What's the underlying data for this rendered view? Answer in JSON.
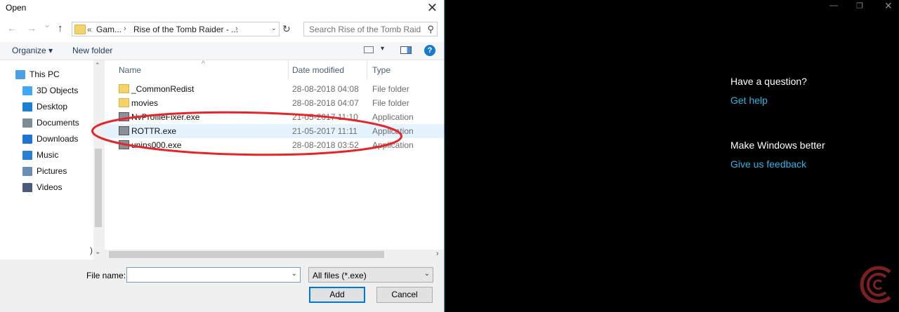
{
  "dialog": {
    "title": "Open",
    "close_glyph": "✕",
    "nav": {
      "back_glyph": "←",
      "forward_glyph": "→",
      "recent_glyph": "⌄",
      "up_glyph": "↑"
    },
    "address": {
      "overflow": "«",
      "crumbs": [
        "Gam...",
        "Rise of the Tomb Raider - ..."
      ],
      "sep_glyph": "›",
      "drop_glyph": "⌄",
      "refresh_glyph": "↻"
    },
    "search": {
      "placeholder": "Search Rise of the Tomb Raid...",
      "icon_glyph": "⚲"
    },
    "toolbar": {
      "organize": "Organize ▾",
      "new_folder": "New folder",
      "view_drop": "▾",
      "help": "?"
    },
    "nav_pane": [
      {
        "label": "This PC",
        "icon": "this-pc-icon",
        "color": "#4aa0e0"
      },
      {
        "label": "3D Objects",
        "icon": "3d-objects-icon",
        "color": "#3fa9f5"
      },
      {
        "label": "Desktop",
        "icon": "desktop-icon",
        "color": "#1b7fd4"
      },
      {
        "label": "Documents",
        "icon": "documents-icon",
        "color": "#7d8b99"
      },
      {
        "label": "Downloads",
        "icon": "downloads-icon",
        "color": "#1e74d0"
      },
      {
        "label": "Music",
        "icon": "music-icon",
        "color": "#2a7fd5"
      },
      {
        "label": "Pictures",
        "icon": "pictures-icon",
        "color": "#6b8fb3"
      },
      {
        "label": "Videos",
        "icon": "videos-icon",
        "color": "#4a5a7a"
      }
    ],
    "nav_pane_scroll_glyph": ")",
    "columns": {
      "name": "Name",
      "date": "Date modified",
      "type": "Type",
      "sort_glyph": "^"
    },
    "files": [
      {
        "name": "_CommonRedist",
        "date": "28-08-2018 04:08",
        "type": "File folder",
        "kind": "folder",
        "selected": false
      },
      {
        "name": "movies",
        "date": "28-08-2018 04:07",
        "type": "File folder",
        "kind": "folder",
        "selected": false
      },
      {
        "name": "NvProfileFixer.exe",
        "date": "21-05-2017 11:10",
        "type": "Application",
        "kind": "exe",
        "selected": false
      },
      {
        "name": "ROTTR.exe",
        "date": "21-05-2017 11:11",
        "type": "Application",
        "kind": "exe",
        "selected": true
      },
      {
        "name": "unins000.exe",
        "date": "28-08-2018 03:52",
        "type": "Application",
        "kind": "exe",
        "selected": false
      }
    ],
    "scroll_glyphs": {
      "up": "⌃",
      "down": "⌄",
      "left": "‹",
      "right": "›"
    },
    "bottom": {
      "file_name_label": "File name:",
      "file_name_value": "",
      "drop_glyph": "⌄",
      "filter": "All files (*.exe)",
      "add": "Add",
      "cancel": "Cancel"
    },
    "annotation_color": "#e3262b"
  },
  "help_panel": {
    "window_controls": {
      "minimize": "—",
      "maximize": "❐",
      "close": "✕"
    },
    "question_title": "Have a question?",
    "get_help": "Get help",
    "better_title": "Make Windows better",
    "feedback": "Give us feedback",
    "link_color": "#2fb5e6"
  }
}
